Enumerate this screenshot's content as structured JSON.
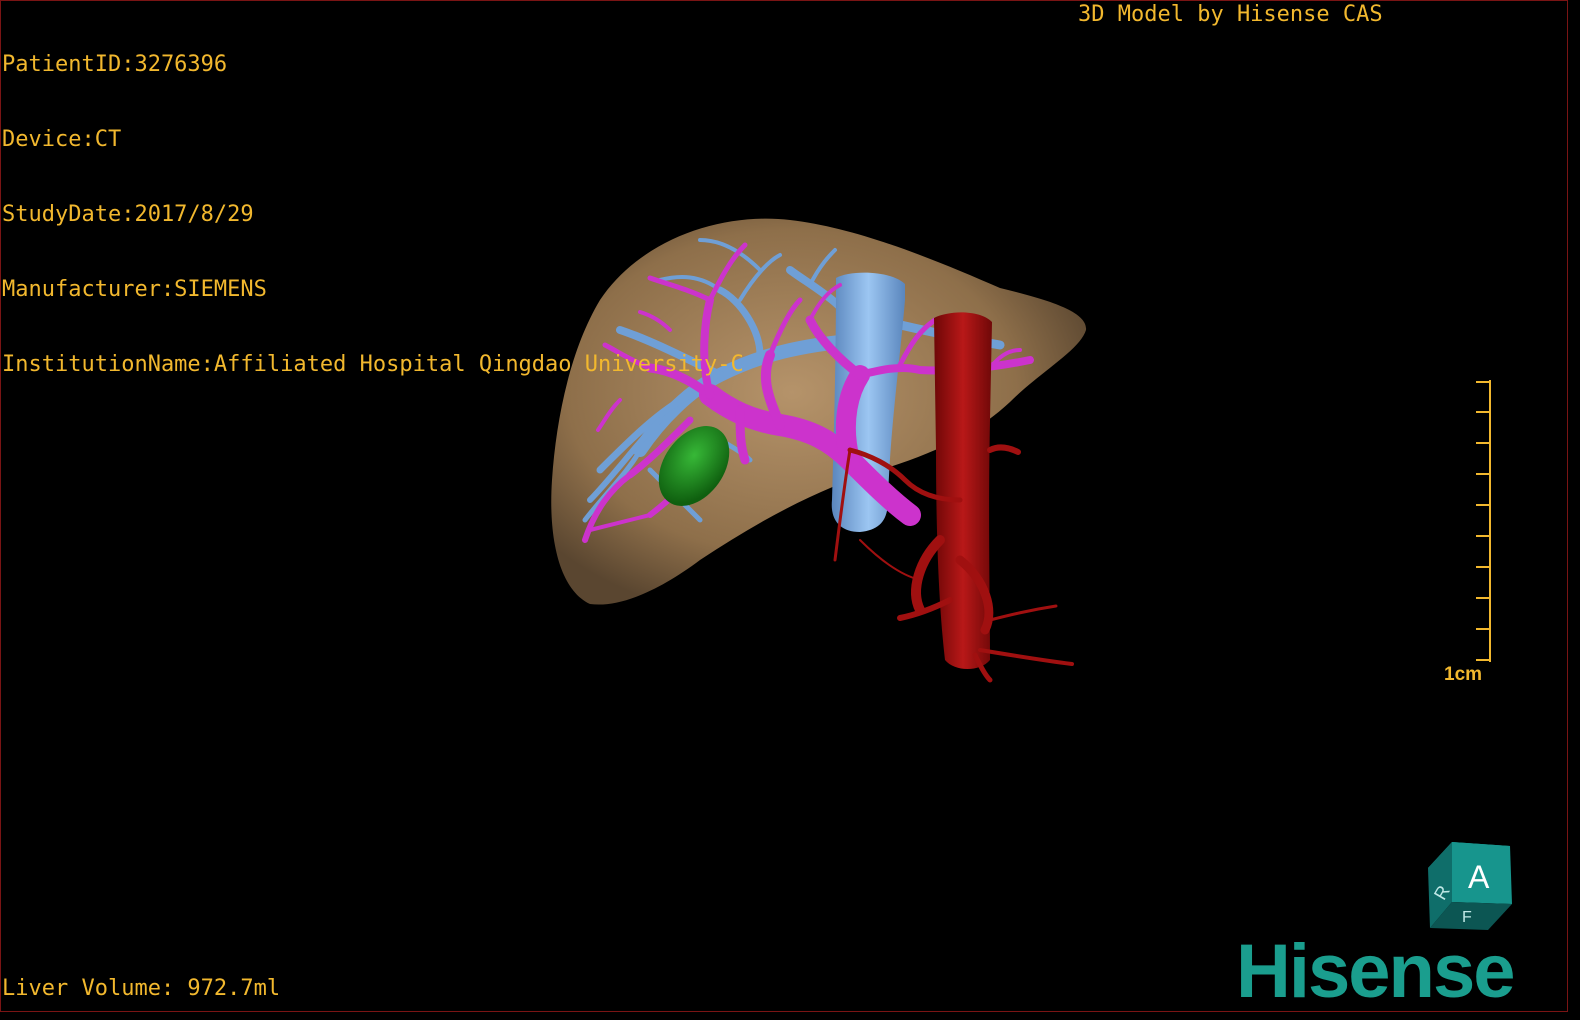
{
  "overlay": {
    "patient_id": "PatientID:3276396",
    "device": "Device:CT",
    "study_date": "StudyDate:2017/8/29",
    "manufacturer": "Manufacturer:SIEMENS",
    "institution": "InstitutionName:Affiliated Hospital Qingdao University-C",
    "model_credit": "3D Model by Hisense CAS",
    "liver_volume": "Liver Volume: 972.7ml"
  },
  "scale_bar": {
    "label": "1cm"
  },
  "orientation_cube": {
    "front_label": "A",
    "side_label": "R",
    "bottom_label": "F"
  },
  "brand": {
    "logo_text": "Hisense"
  },
  "colors": {
    "text": "#f2b82e",
    "liver": "#9c7a52",
    "portal_vein": "#cc33cc",
    "hepatic_vein": "#6f9fd6",
    "ivc": "#7ab0e8",
    "artery": "#a01010",
    "gallbladder": "#1e8a1e",
    "logo": "#1a9e8e",
    "cube": "#178a84"
  }
}
